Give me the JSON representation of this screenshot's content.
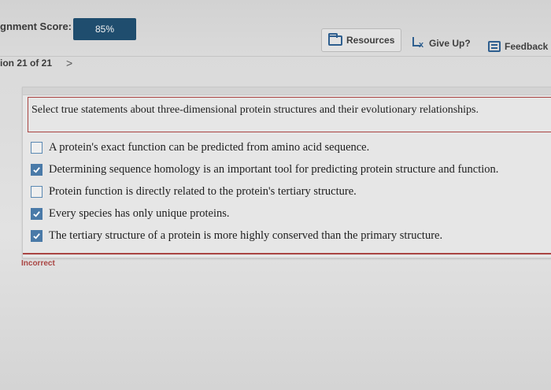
{
  "header": {
    "score_label": "gnment Score:",
    "score_value": "85%",
    "resources_label": "Resources",
    "giveup_label": "Give Up?",
    "feedback_label": "Feedback"
  },
  "nav": {
    "question_label": "ion 21 of 21",
    "next_symbol": ">"
  },
  "question": {
    "prompt": "Select true statements about three-dimensional protein structures and their evolutionary relationships.",
    "options": [
      {
        "label": "A protein's exact function can be predicted from amino acid sequence.",
        "checked": false
      },
      {
        "label": "Determining sequence homology is an important tool for predicting protein structure and function.",
        "checked": true
      },
      {
        "label": "Protein function is directly related to the protein's tertiary structure.",
        "checked": false
      },
      {
        "label": "Every species has only unique proteins.",
        "checked": true
      },
      {
        "label": "The tertiary structure of a protein is more highly conserved than the primary structure.",
        "checked": true
      }
    ],
    "result": "Incorrect"
  },
  "colors": {
    "score_pill": "#1f4d6e",
    "accent_icon": "#2f5f8f",
    "checkbox_checked": "#4a7aa8",
    "incorrect": "#a94442"
  }
}
